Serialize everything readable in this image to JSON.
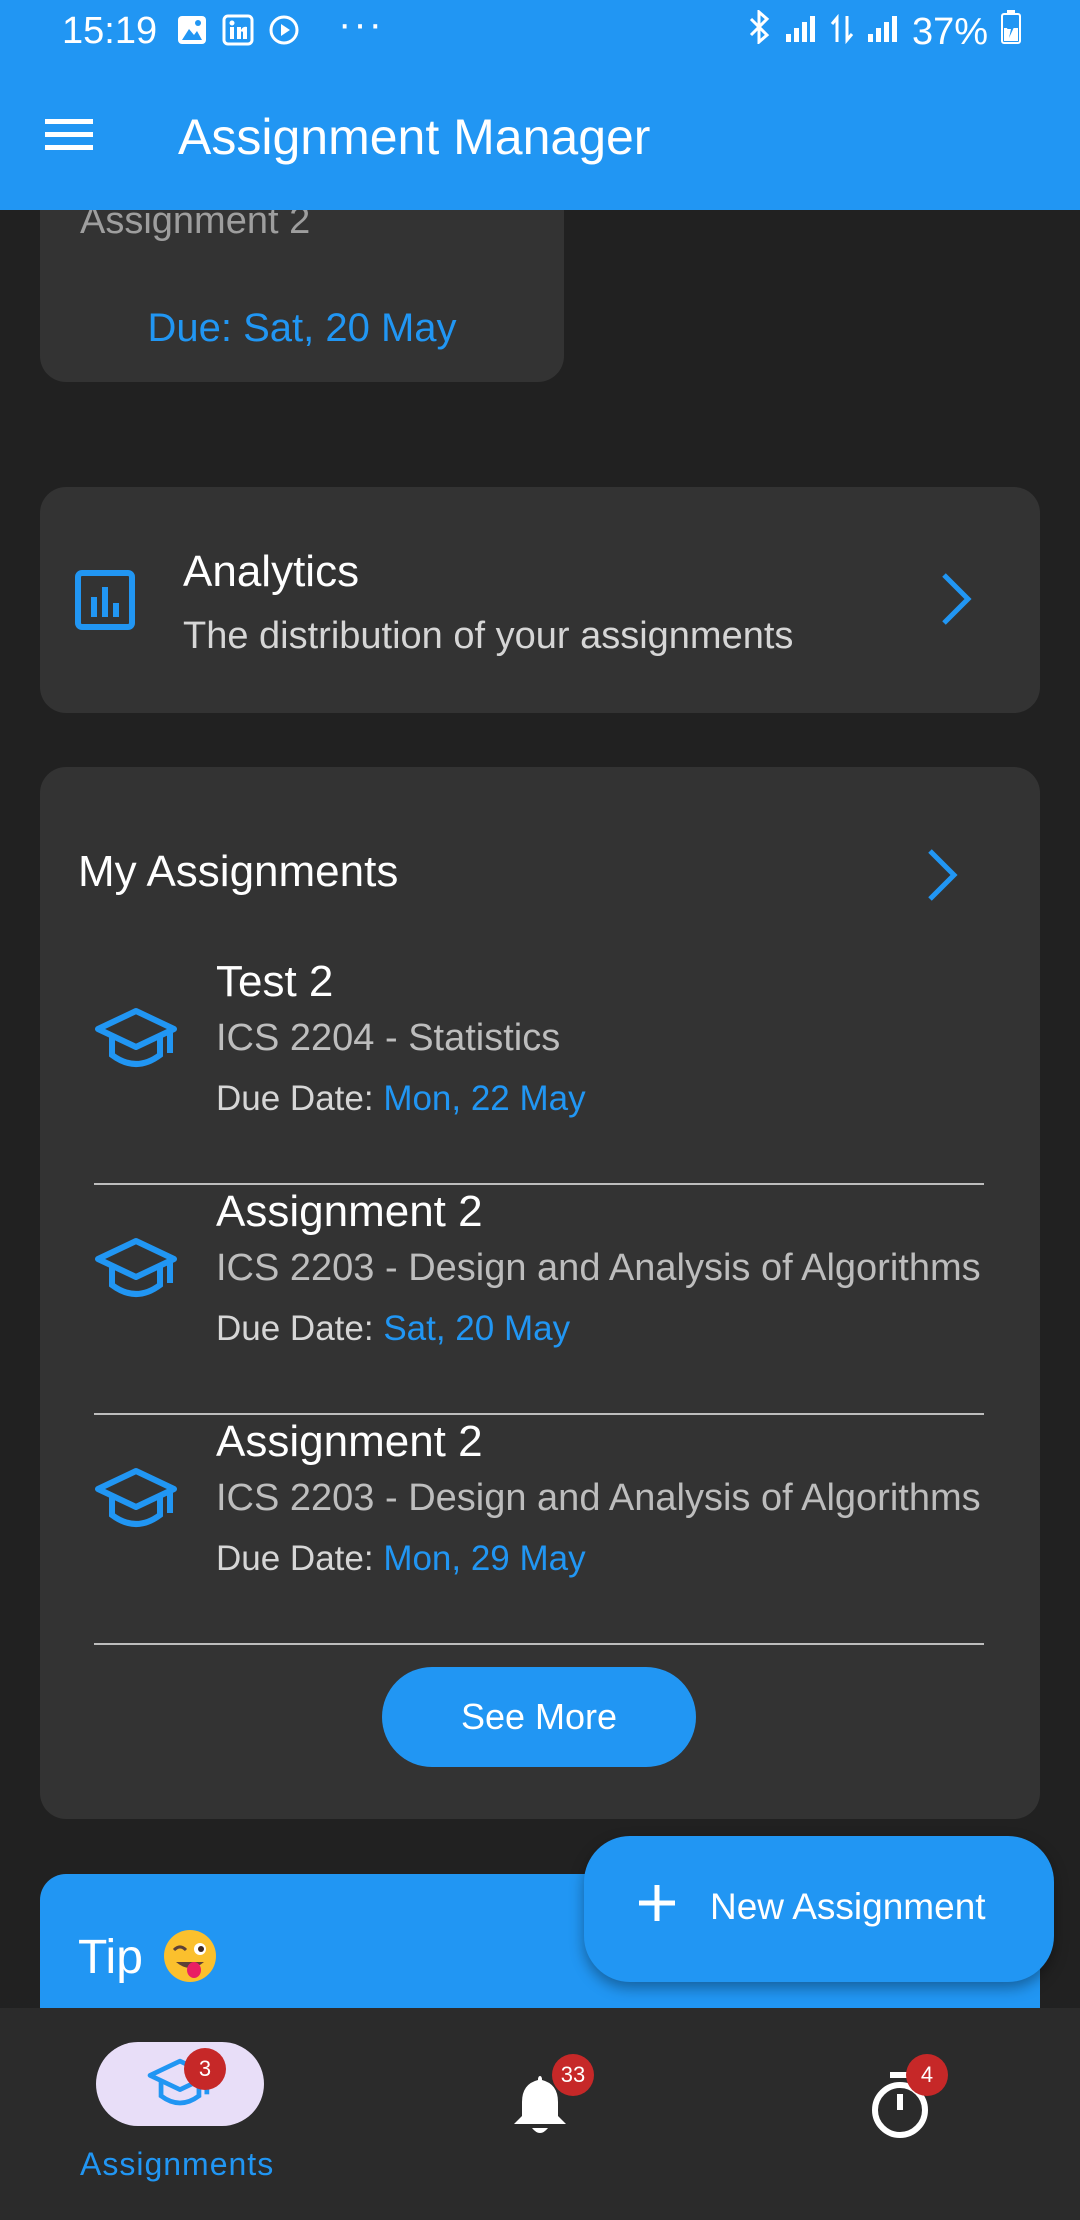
{
  "status_bar": {
    "time": "15:19",
    "battery": "37%"
  },
  "app_bar": {
    "title": "Assignment Manager"
  },
  "previous_card": {
    "title": "Assignment 2",
    "due": "Due: Sat, 20 May"
  },
  "analytics": {
    "title": "Analytics",
    "subtitle": "The distribution of your assignments"
  },
  "my_assignments": {
    "title": "My Assignments",
    "due_prefix": "Due Date: ",
    "items": [
      {
        "name": "Test 2",
        "course": "ICS 2204 - Statistics",
        "due_date": "Mon, 22 May"
      },
      {
        "name": "Assignment 2",
        "course": "ICS 2203 - Design and Analysis of Algorithms",
        "due_date": "Sat, 20 May"
      },
      {
        "name": "Assignment 2",
        "course": "ICS 2203 - Design and Analysis of Algorithms",
        "due_date": "Mon, 29 May"
      }
    ],
    "see_more_label": "See More"
  },
  "tip": {
    "title": "Tip"
  },
  "fab": {
    "label": "New Assignment"
  },
  "bottom_nav": {
    "assignments": {
      "label": "Assignments",
      "badge": "3"
    },
    "notifications": {
      "badge": "33"
    },
    "timer": {
      "badge": "4"
    }
  },
  "colors": {
    "accent": "#2196f3",
    "background": "#212121",
    "card": "#333333",
    "badge": "#c62828"
  },
  "icons": [
    "menu-icon",
    "analytics-icon",
    "chevron-right-icon",
    "graduation-cap-icon",
    "plus-icon",
    "bell-icon",
    "timer-icon",
    "winking-face-emoji"
  ]
}
